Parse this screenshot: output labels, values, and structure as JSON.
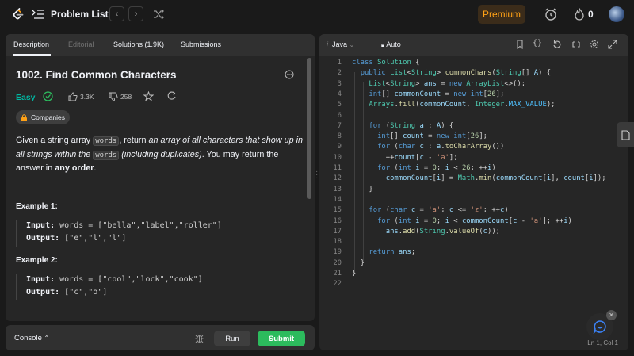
{
  "topbar": {
    "title": "Problem List",
    "premium_label": "Premium",
    "streak_count": "0",
    "prev_icon": "chevron-left-icon",
    "next_icon": "chevron-right-icon"
  },
  "left_tabs": [
    {
      "label": "Description"
    },
    {
      "label": "Editorial"
    },
    {
      "label": "Solutions (1.9K)"
    },
    {
      "label": "Submissions"
    }
  ],
  "problem": {
    "title": "1002. Find Common Characters",
    "difficulty": "Easy",
    "likes": "3.3K",
    "dislikes": "258",
    "companies_label": "Companies",
    "desc_1": "Given a string array ",
    "desc_code1": "words",
    "desc_2": ", return ",
    "desc_em1": "an array of all characters that show up in all strings within the ",
    "desc_code2": "words",
    "desc_em2": " (including duplicates)",
    "desc_3": ". You may return the answer in ",
    "desc_bold": "any order",
    "desc_4": ".",
    "examples": [
      {
        "heading": "Example 1:",
        "input_label": "Input:",
        "input_value": " words = [\"bella\",\"label\",\"roller\"]",
        "output_label": "Output:",
        "output_value": " [\"e\",\"l\",\"l\"]"
      },
      {
        "heading": "Example 2:",
        "input_label": "Input:",
        "input_value": " words = [\"cool\",\"lock\",\"cook\"]",
        "output_label": "Output:",
        "output_value": " [\"c\",\"o\"]"
      }
    ]
  },
  "bottom_bar": {
    "console_label": "Console",
    "run_label": "Run",
    "submit_label": "Submit"
  },
  "editor": {
    "language": "Java",
    "autosave": "Auto",
    "status": "Ln 1, Col 1",
    "line_numbers": [
      "1",
      "2",
      "3",
      "4",
      "5",
      "6",
      "7",
      "8",
      "9",
      "10",
      "11",
      "12",
      "13",
      "14",
      "15",
      "16",
      "17",
      "18",
      "19",
      "20",
      "21",
      "22"
    ]
  },
  "colors": {
    "accent": "#ffa116",
    "easy": "#00b8a3",
    "submit": "#2cbb5d"
  }
}
